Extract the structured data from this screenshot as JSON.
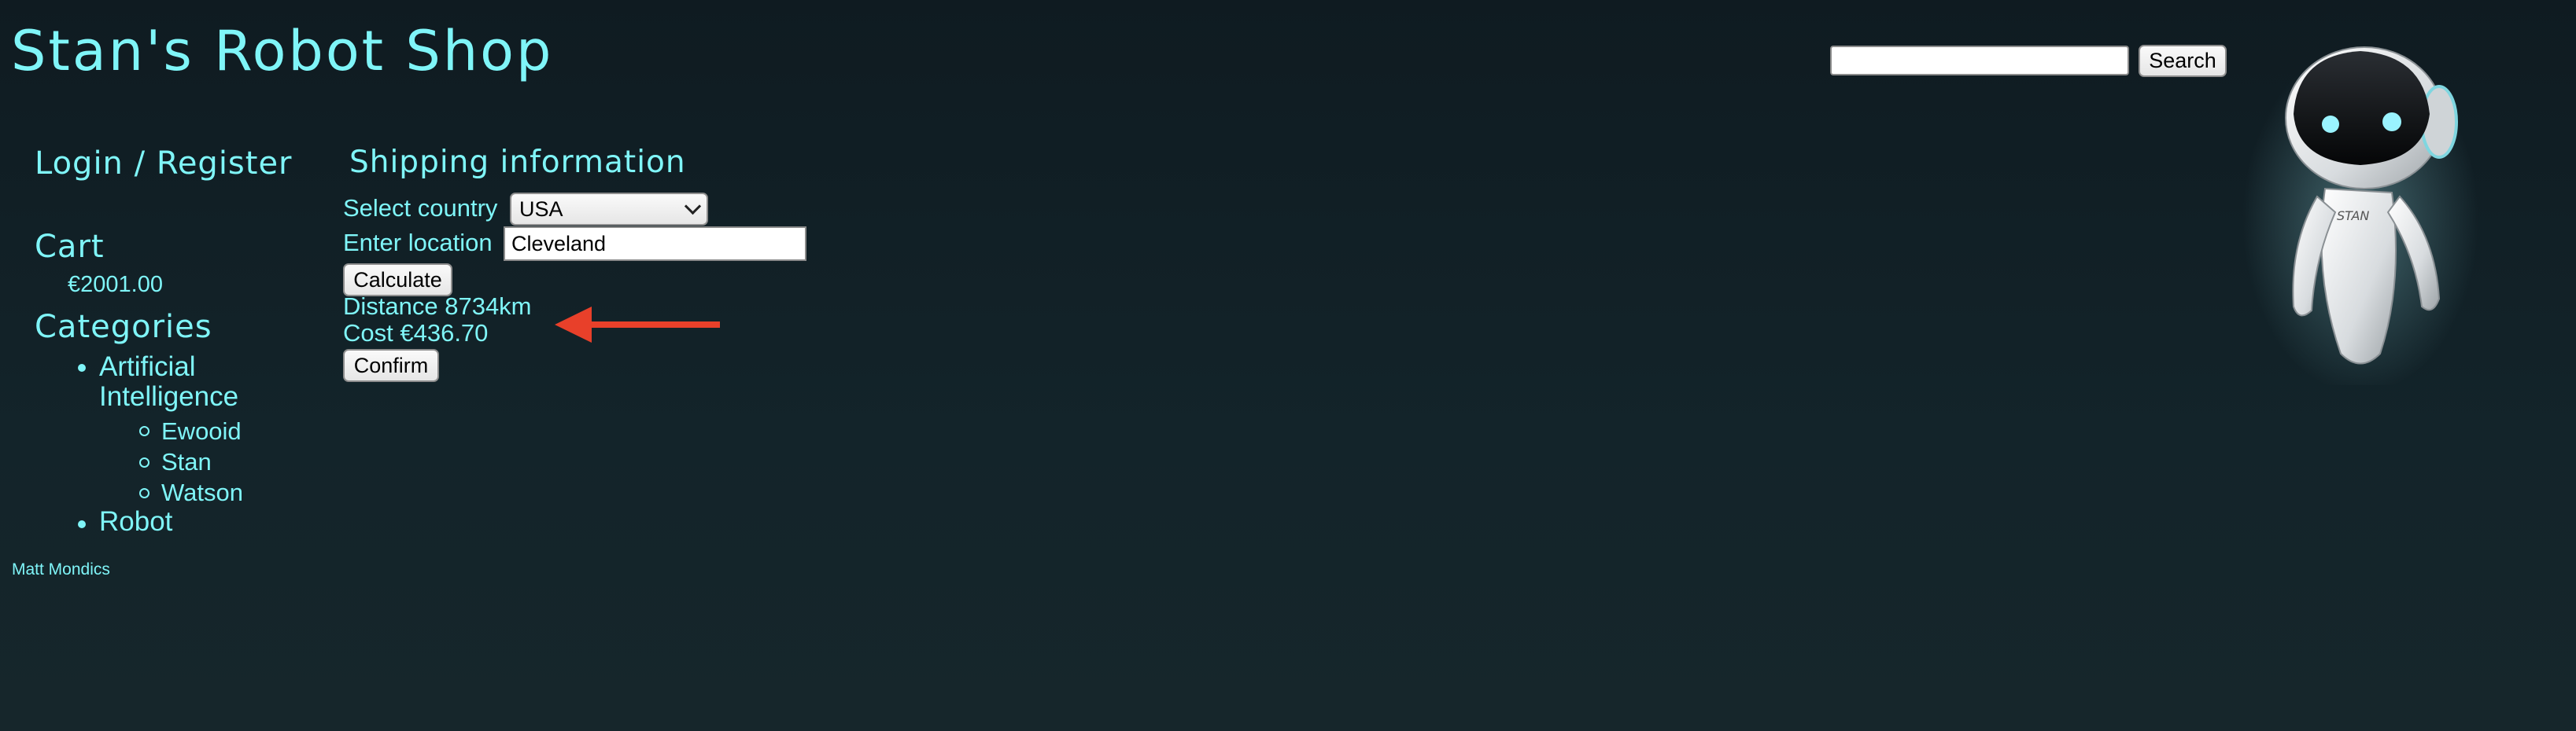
{
  "header": {
    "site_title": "Stan's Robot Shop",
    "search_button": "Search",
    "search_value": ""
  },
  "sidebar": {
    "login_label": "Login / Register",
    "cart_label": "Cart",
    "cart_total": "€2001.00",
    "categories_label": "Categories",
    "categories": [
      {
        "label": "Artificial Intelligence",
        "items": [
          "Ewooid",
          "Stan",
          "Watson"
        ]
      },
      {
        "label": "Robot",
        "items": []
      }
    ]
  },
  "shipping": {
    "heading": "Shipping information",
    "country_label": "Select country",
    "country_value": "USA",
    "location_label": "Enter location",
    "location_value": "Cleveland",
    "calculate_button": "Calculate",
    "distance_text": "Distance 8734km",
    "cost_text": "Cost €436.70",
    "confirm_button": "Confirm"
  },
  "footer": {
    "author": "Matt Mondics"
  },
  "colors": {
    "accent": "#7ff5f8",
    "background": "#112026",
    "annotation_arrow": "#e8402a"
  }
}
